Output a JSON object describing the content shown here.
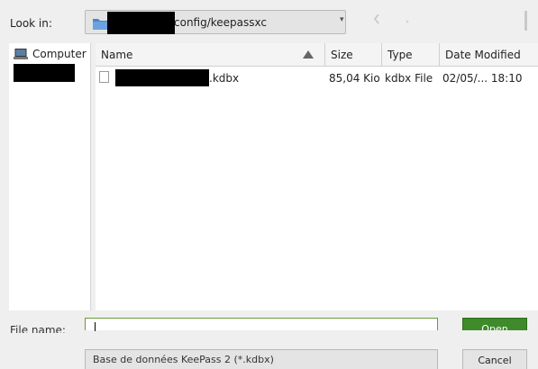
{
  "toolbar": {
    "look_in_label": "Look in:",
    "path_text": "config/keepassxc",
    "combo_arrow": "▾",
    "icons": [
      "back-icon",
      "forward-icon"
    ]
  },
  "sidebar": {
    "items": [
      {
        "label": "Computer",
        "icon": "computer-icon"
      }
    ]
  },
  "file_list": {
    "columns": [
      "Name",
      "Size",
      "Type",
      "Date Modified"
    ],
    "rows": [
      {
        "name_suffix": ".kdbx",
        "size": "85,04 Kio",
        "type": "kdbx File",
        "modified": "02/05/... 18:10"
      }
    ]
  },
  "form": {
    "file_name_label": "File name:",
    "file_name_value": "",
    "open_label": "Open",
    "filter_text": "Base de données KeePass 2 (*.kdbx)",
    "cancel_label": "Cancel"
  },
  "colors": {
    "accent": "#3f8a2a",
    "focus_border": "#6a9a3a"
  }
}
